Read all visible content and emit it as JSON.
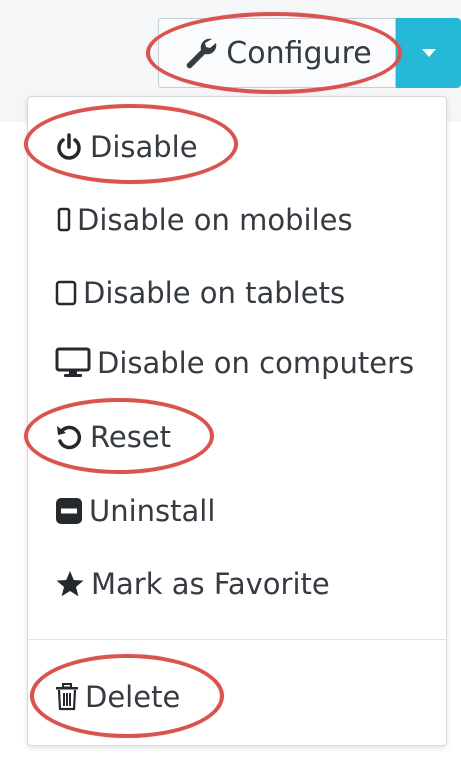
{
  "toolbar": {
    "configure_label": "Configure",
    "configure_icon": "wrench-icon",
    "dropdown_icon": "caret-down-icon",
    "accent": "#25b9d7"
  },
  "menu": {
    "items": [
      {
        "label": "Disable",
        "icon": "power-icon"
      },
      {
        "label": "Disable on mobiles",
        "icon": "mobile-icon"
      },
      {
        "label": "Disable on tablets",
        "icon": "tablet-icon"
      },
      {
        "label": "Disable on computers",
        "icon": "desktop-icon"
      },
      {
        "label": "Reset",
        "icon": "undo-icon"
      },
      {
        "label": "Uninstall",
        "icon": "minus-square-icon"
      },
      {
        "label": "Mark as Favorite",
        "icon": "star-icon"
      },
      {
        "label": "Delete",
        "icon": "trash-icon"
      }
    ]
  },
  "highlight_color": "#d9534f"
}
